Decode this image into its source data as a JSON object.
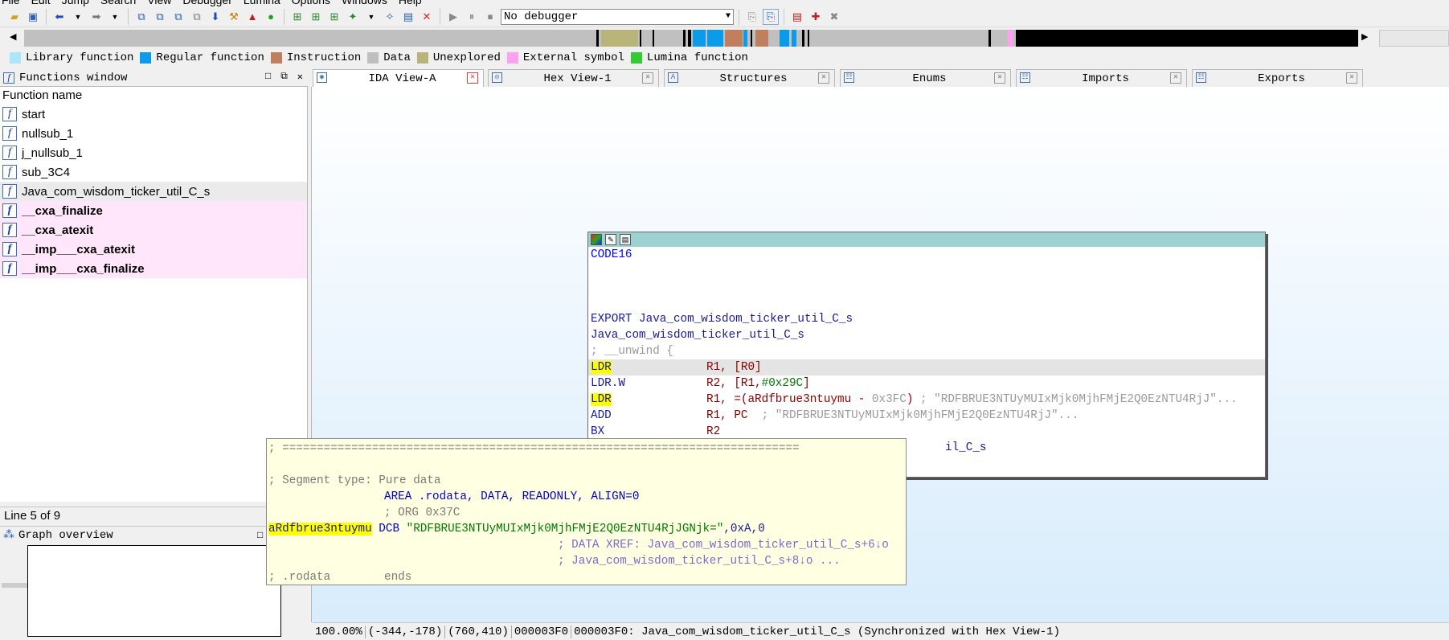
{
  "menu": [
    "File",
    "Edit",
    "Jump",
    "Search",
    "View",
    "Debugger",
    "Lumina",
    "Options",
    "Windows",
    "Help"
  ],
  "toolbar": {
    "debugger_value": "No debugger"
  },
  "legend": [
    {
      "label": "Library function",
      "color": "#aae7ff"
    },
    {
      "label": "Regular function",
      "color": "#0a9bea"
    },
    {
      "label": "Instruction",
      "color": "#c08060"
    },
    {
      "label": "Data",
      "color": "#c0c0c0"
    },
    {
      "label": "Unexplored",
      "color": "#b8b47a"
    },
    {
      "label": "External symbol",
      "color": "#ffa0f0"
    },
    {
      "label": "Lumina function",
      "color": "#33cc33"
    }
  ],
  "functions_window": {
    "title": "Functions window",
    "column_header": "Function name",
    "items": [
      {
        "name": "start",
        "kind": "regular"
      },
      {
        "name": "nullsub_1",
        "kind": "regular"
      },
      {
        "name": "j_nullsub_1",
        "kind": "regular"
      },
      {
        "name": "sub_3C4",
        "kind": "regular"
      },
      {
        "name": "Java_com_wisdom_ticker_util_C_s",
        "kind": "selected"
      },
      {
        "name": "__cxa_finalize",
        "kind": "external"
      },
      {
        "name": "__cxa_atexit",
        "kind": "external"
      },
      {
        "name": "__imp___cxa_atexit",
        "kind": "external"
      },
      {
        "name": "__imp___cxa_finalize",
        "kind": "external"
      }
    ],
    "status": "Line 5 of 9"
  },
  "graph_overview": {
    "title": "Graph overview"
  },
  "tabs": [
    {
      "label": "IDA View-A",
      "active": true
    },
    {
      "label": "Hex View-1",
      "active": false
    },
    {
      "label": "Structures",
      "active": false
    },
    {
      "label": "Enums",
      "active": false
    },
    {
      "label": "Imports",
      "active": false
    },
    {
      "label": "Exports",
      "active": false
    }
  ],
  "code_node": {
    "segment": "CODE16",
    "export_line": "EXPORT Java_com_wisdom_ticker_util_C_s",
    "func_label": "Java_com_wisdom_ticker_util_C_s",
    "unwind": "; __unwind {",
    "lines": [
      {
        "mnem": "LDR",
        "ops": "R1, [R0]"
      },
      {
        "mnem": "LDR.W",
        "ops": "R2, [R1,#0x29C]"
      },
      {
        "mnem": "LDR",
        "ops": "R1, =(aRdfbrue3ntuymu - 0x3FC) ; \"RDFBRUE3NTUyMUIxMjk0MjhFMjE2Q0EzNTU4RjJ\"..."
      },
      {
        "mnem": "ADD",
        "ops": "R1, PC  ; \"RDFBRUE3NTUyMUIxMjk0MjhFMjE2Q0EzNTU4RjJ\"..."
      },
      {
        "mnem": "BX",
        "ops": "R2"
      }
    ],
    "tail_partial": "il_C_s"
  },
  "hint": {
    "separator": "; ===========================================================================",
    "segment_type_comment": "; Segment type:",
    "segment_type_value": "Pure data",
    "area_line": "AREA .rodata, DATA, READONLY, ALIGN=0",
    "org_line": "; ORG 0x37C",
    "label": "aRdfbrue3ntuymu",
    "directive": "DCB",
    "string_value": "\"RDFBRUE3NTUyMUIxMjk0MjhFMjE2Q0EzNTU4RjJGNjk=\"",
    "trailing": ",0xA,0",
    "xref1": "; DATA XREF: Java_com_wisdom_ticker_util_C_s+6↓o",
    "xref2": "; Java_com_wisdom_ticker_util_C_s+8↓o ...",
    "ends_label": "; .rodata",
    "ends": "ends"
  },
  "status_bar": {
    "zoom": "100.00%",
    "cursor": "(-344,-178)",
    "size": "(760,410)",
    "offset": "000003F0",
    "location": "000003F0: Java_com_wisdom_ticker_util_C_s (Synchronized with Hex View-1)"
  }
}
